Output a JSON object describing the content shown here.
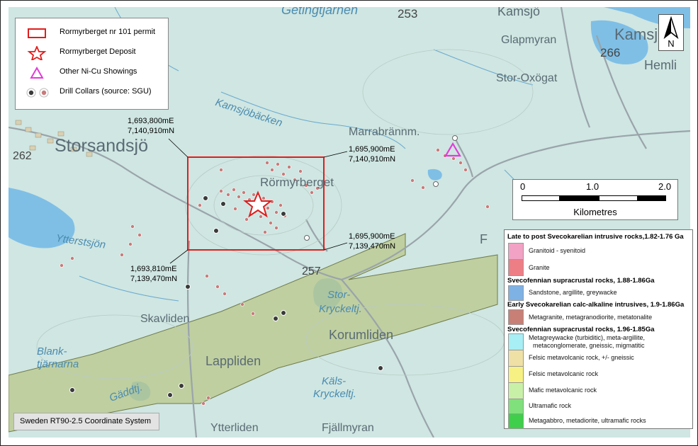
{
  "legend": {
    "items": [
      {
        "label": "Rormyrberget nr 101 permit",
        "icon": "red-rectangle-icon"
      },
      {
        "label": "Rormyrberget Deposit",
        "icon": "red-star-icon"
      },
      {
        "label": "Other Ni-Cu Showings",
        "icon": "magenta-triangle-icon"
      },
      {
        "label": "Drill Collars (source: SGU)",
        "icon": "drill-collar-icon"
      }
    ]
  },
  "north_arrow": {
    "label": "N"
  },
  "scale_bar": {
    "ticks": [
      "0",
      "1.0",
      "2.0"
    ],
    "unit": "Kilometres"
  },
  "coordinate_system": "Sweden RT90-2.5 Coordinate System",
  "corners": {
    "nw": [
      "1,693,800mE",
      "7,140,910mN"
    ],
    "ne": [
      "1,695,900mE",
      "7,140,910mN"
    ],
    "se": [
      "1,695,900mE",
      "7,139,470mN"
    ],
    "sw": [
      "1,693,810mE",
      "7,139,470mN"
    ]
  },
  "places": {
    "storsandsjo": "Storsandsjö",
    "rormyrberget": "Rörmyrberget",
    "kamsjobacken": "Kamsjöbäcken",
    "marrabrannm": "Marrabrännm.",
    "glapmyran": "Glapmyran",
    "stor_oxogat": "Stor-Oxögat",
    "kamsjo": "Kamsjö",
    "kamsjo2": "Kamsj",
    "hemli": "Hemli",
    "getingtjarnen": "Getingtjärnen",
    "ytterstsjon": "Ytterstsjön",
    "skavliden": "Skavliden",
    "stor": "Stor-",
    "kryckeltj": "Kryckeltj.",
    "korumliden": "Korumliden",
    "lappliden": "Lappliden",
    "blank": "Blank-",
    "tjarnarna": "tjärnarna",
    "gaddtj": "Gäddtj.",
    "kals": "Käls-",
    "kryckeltj2": "Kryckeltj.",
    "ytterliden": "Ytterliden",
    "fjallmyran": "Fjällmyran",
    "f": "F",
    "road253": "253",
    "road262": "262",
    "road266": "266",
    "road257": "257"
  },
  "geology_legend": {
    "groups": [
      {
        "heading": "Late to post Svecokarelian intrusive rocks,1.82-1.76 Ga",
        "entries": [
          {
            "label": "Granitoid - syenitoid",
            "color": "#f2a2c4"
          },
          {
            "label": "Granite",
            "color": "#ee7e86"
          }
        ]
      },
      {
        "heading": "Svecofennian supracrustal rocks, 1.88-1.86Ga",
        "entries": [
          {
            "label": "Sandstone, argillite, greywacke",
            "color": "#7fb2e4"
          }
        ]
      },
      {
        "heading": "Early Svecokarelian calc-alkaline intrusives, 1.9-1.86Ga",
        "entries": [
          {
            "label": "Metagranite, metagranodiorite, metatonalite",
            "color": "#c87f76"
          }
        ]
      },
      {
        "heading": "Svecofennian supracrustal rocks, 1.96-1.85Ga",
        "entries": [
          {
            "label": "Metagreywacke (turbiditic), meta-argillite,",
            "label2": "metaconglomerate, gneissic, migmatitic",
            "color": "#a8eef5"
          },
          {
            "label": "Felsic metavolcanic rock, +/- gneissic",
            "color": "#efe0a6"
          },
          {
            "label": "Felsic metavolcanic rock",
            "color": "#f6f182"
          },
          {
            "label": "Mafic metavolcanic rock",
            "color": "#c9f0a7"
          },
          {
            "label": "Ultramafic rock",
            "color": "#7fe07c"
          },
          {
            "label": "Metagabbro, metadiorite, ultramafic rocks",
            "color": "#3fcf4a"
          }
        ]
      }
    ]
  },
  "colors": {
    "permit": "#e01d1d",
    "deposit": "#e01d1d",
    "showing": "#e33bd8",
    "collar_black": "#3a3a3a",
    "collar_red": "#c97a7a",
    "land": "#cfe6e2",
    "water": "#7fbfe6",
    "belt": "#b9c78a"
  }
}
